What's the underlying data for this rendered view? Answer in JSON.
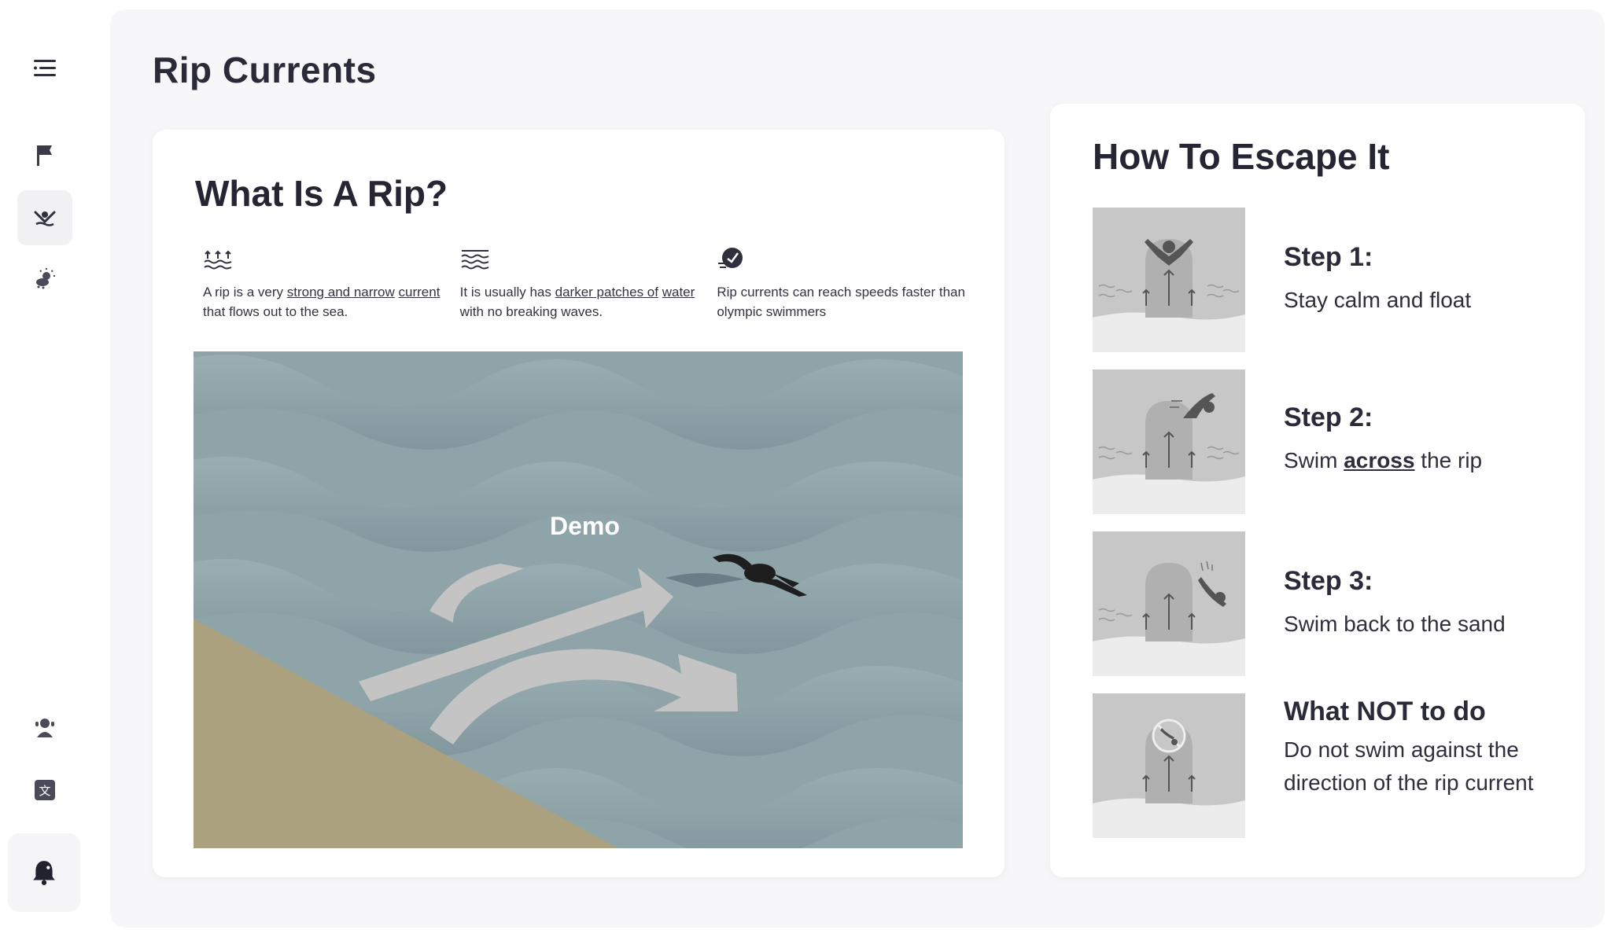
{
  "page": {
    "title": "Rip Currents"
  },
  "sidebar": {
    "items": [
      {
        "name": "menu",
        "icon": "menu-icon"
      },
      {
        "name": "flag",
        "icon": "flag-icon"
      },
      {
        "name": "swimmer",
        "icon": "swimmer-icon",
        "active": true
      },
      {
        "name": "weather",
        "icon": "weather-icon"
      },
      {
        "name": "lifeguard",
        "icon": "lifeguard-icon"
      },
      {
        "name": "translate",
        "icon": "translate-icon"
      },
      {
        "name": "alert",
        "icon": "bell-icon"
      }
    ]
  },
  "what": {
    "title": "What Is A Rip?",
    "facts": [
      {
        "icon": "waves-arrows-icon",
        "pre": "A rip is a very ",
        "link1": "strong and narrow",
        "mid": " ",
        "link2": "current",
        "post": " that flows out to the sea."
      },
      {
        "icon": "waves-icon",
        "pre": "It is usually has ",
        "link1": "darker patches of",
        "mid": " ",
        "link2": "water",
        "post": " with no breaking waves."
      },
      {
        "icon": "speed-icon",
        "text": "Rip currents can reach speeds faster than olympic swimmers"
      }
    ],
    "demo_label": "Demo"
  },
  "escape": {
    "title": "How To Escape It",
    "steps": [
      {
        "title": "Step 1:",
        "desc": "Stay calm and float"
      },
      {
        "title": "Step 2:",
        "desc_pre": "Swim ",
        "desc_strong": "across",
        "desc_post": " the rip"
      },
      {
        "title": "Step 3:",
        "desc": "Swim back to the sand"
      },
      {
        "title": "What NOT to do",
        "desc": "Do not swim against the direction of the rip current"
      }
    ]
  },
  "colors": {
    "text": "#2a2a38",
    "sand": "#aca17f",
    "water": "#8ea3a8",
    "panel": "#f7f7f9"
  }
}
